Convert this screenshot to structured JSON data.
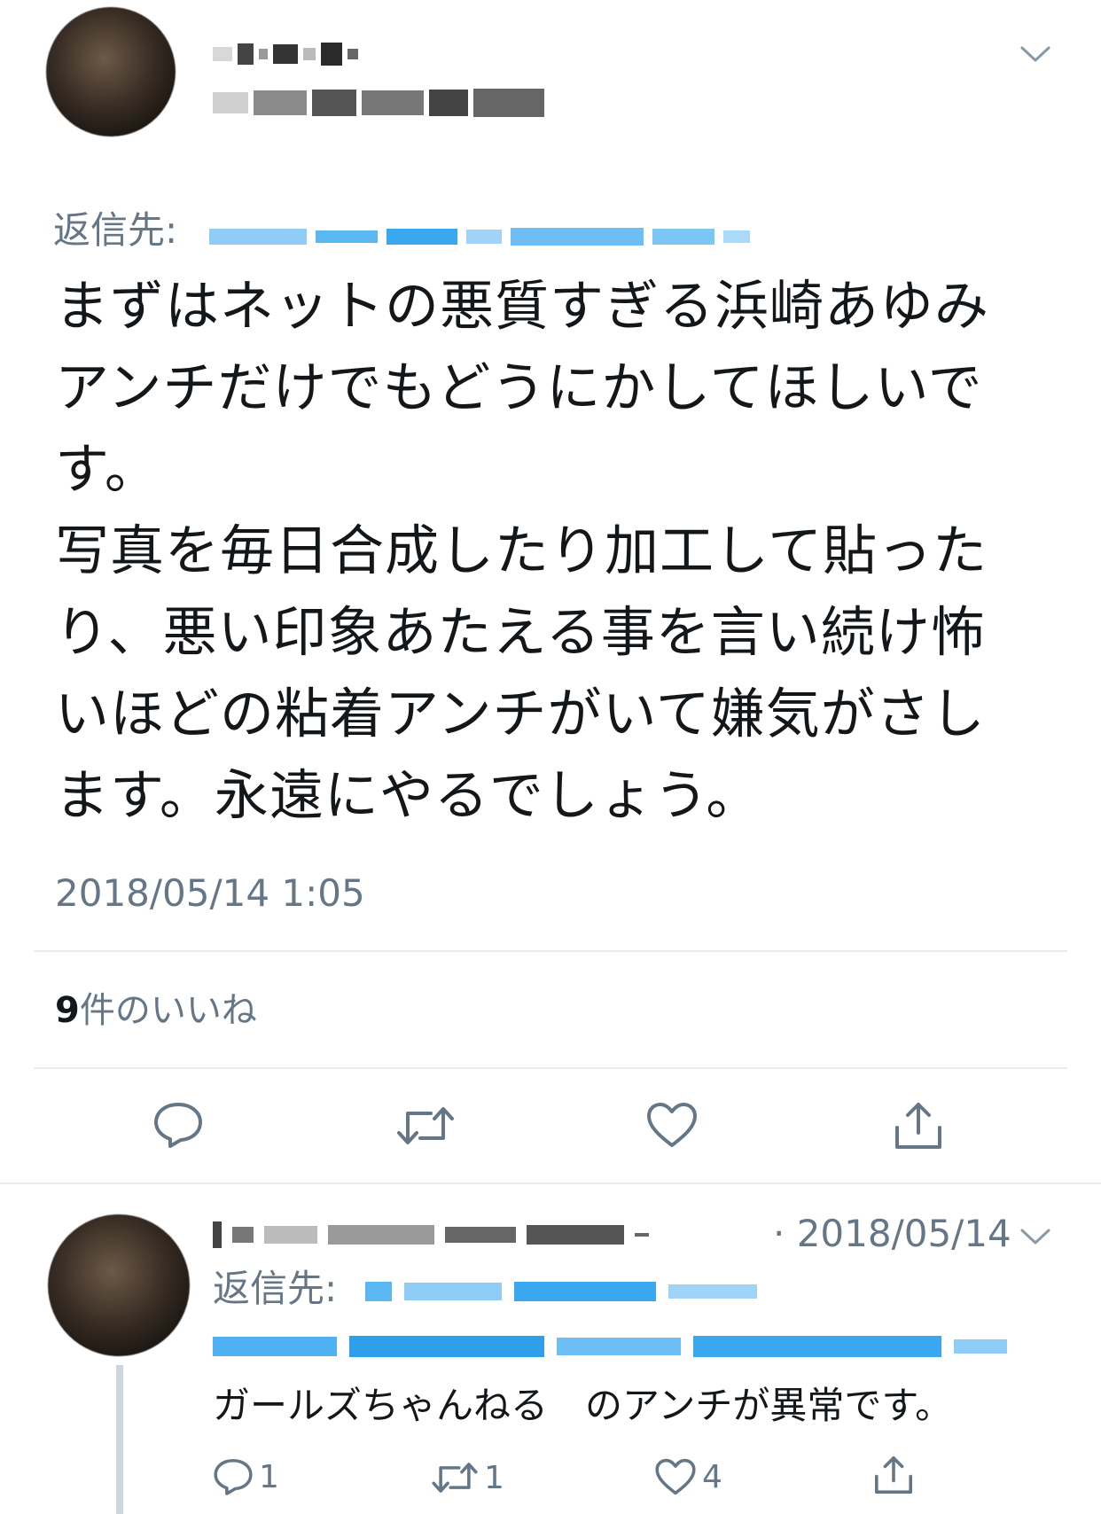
{
  "main_tweet": {
    "reply_prefix": "返信先:",
    "text_lines": [
      "まずはネットの悪質すぎる浜崎あゆみ",
      "アンチだけでもどうにかしてほしいで",
      "す。",
      "写真を毎日合成したり加工して貼った",
      "り、悪い印象あたえる事を言い続け怖",
      "いほどの粘着アンチがいて嫌気がさし",
      "ます。永遠にやるでしょう。"
    ],
    "timestamp": "2018/05/14 1:05",
    "likes_count": "9",
    "likes_label": "件のいいね",
    "icons": {
      "reply": "reply-icon",
      "retweet": "retweet-icon",
      "like": "heart-icon",
      "share": "share-icon",
      "menu": "chevron-down-icon"
    }
  },
  "reply_tweet": {
    "date": "· 2018/05/14",
    "reply_prefix": "返信先:",
    "text": "ガールズちゃんねる　のアンチが異常です。",
    "reply_count": "1",
    "retweet_count": "1",
    "like_count": "4"
  },
  "colors": {
    "text": "#14171a",
    "secondary": "#657786",
    "link": "#1da1f2",
    "divider": "#e6ecf0"
  }
}
